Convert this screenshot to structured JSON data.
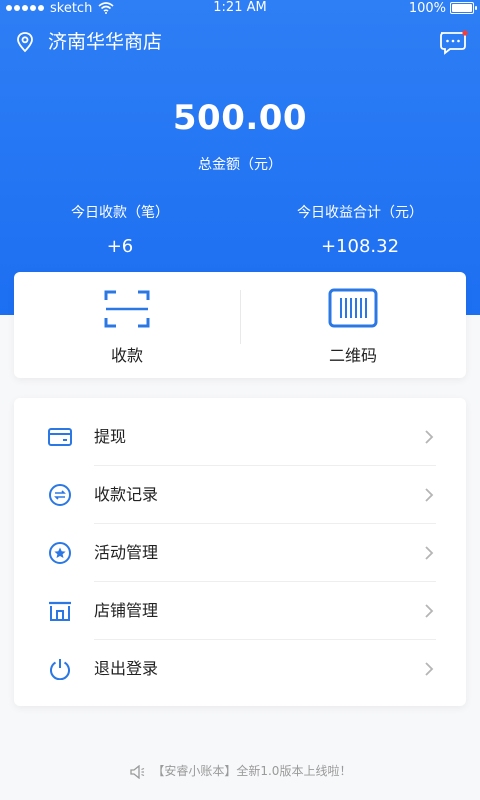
{
  "status_bar": {
    "carrier": "sketch",
    "time": "1:21 AM",
    "battery": "100%"
  },
  "header": {
    "store_name": "济南华华商店",
    "total_amount": "500.00",
    "total_label": "总金额（元）",
    "today_count_label": "今日收款（笔）",
    "today_count_value": "+6",
    "today_income_label": "今日收益合计（元）",
    "today_income_value": "+108.32"
  },
  "actions": [
    {
      "label": "收款",
      "icon": "scan-icon"
    },
    {
      "label": "二维码",
      "icon": "barcode-icon"
    }
  ],
  "menu": [
    {
      "label": "提现",
      "icon": "card-icon"
    },
    {
      "label": "收款记录",
      "icon": "exchange-icon"
    },
    {
      "label": "活动管理",
      "icon": "star-icon"
    },
    {
      "label": "店铺管理",
      "icon": "store-icon"
    },
    {
      "label": "退出登录",
      "icon": "power-icon"
    }
  ],
  "notice": "【安睿小账本】全新1.0版本上线啦！",
  "colors": {
    "primary": "#1d6ff2",
    "icon_blue": "#2b78e4"
  }
}
